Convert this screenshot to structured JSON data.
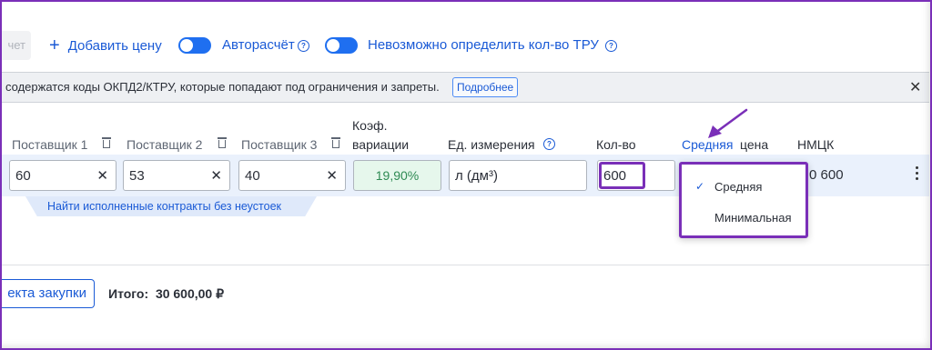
{
  "toolbar": {
    "partial_button_label": "чет",
    "add_price_icon": "plus-icon",
    "add_price_label": "Добавить цену",
    "auto_calc_label": "Авторасчёт",
    "auto_calc_on": true,
    "cannot_determine_label": "Невозможно определить кол-во ТРУ",
    "cannot_determine_on": true,
    "help_glyph": "?"
  },
  "banner": {
    "text": "содержатся коды ОКПД2/КТРУ, которые попадают под ограничения и запреты.",
    "more_label": "Подробнее",
    "close_glyph": "✕"
  },
  "columns": {
    "supplier1": "Поставщик 1",
    "supplier2": "Поставщик 2",
    "supplier3": "Поставщик 3",
    "variation_line1": "Коэф.",
    "variation_line2": "вариации",
    "unit": "Ед. измерения",
    "qty": "Кол-во",
    "price_type_link": "Средняя",
    "price_type_suffix": "цена",
    "nmck": "НМЦК"
  },
  "row": {
    "supplier1_value": "60",
    "supplier2_value": "53",
    "supplier3_value": "40",
    "clear_glyph": "✕",
    "variation_value": "19,90%",
    "unit_value": "л (дм³)",
    "qty_value": "600",
    "nmck_value": "0 600",
    "find_contracts_link": "Найти исполненные контракты без неустоек"
  },
  "dropdown": {
    "selected": "Средняя",
    "options": [
      "Средняя",
      "Минимальная"
    ],
    "check_glyph": "✓"
  },
  "footer": {
    "partial_button_label": "екта закупки",
    "total_label": "Итого:",
    "total_value": "30 600,00 ₽"
  },
  "colors": {
    "accent": "#1a5ad6",
    "highlight": "#7a2fb8",
    "variation_bg": "#e6f7ec",
    "row_band": "#eaf1fc"
  }
}
